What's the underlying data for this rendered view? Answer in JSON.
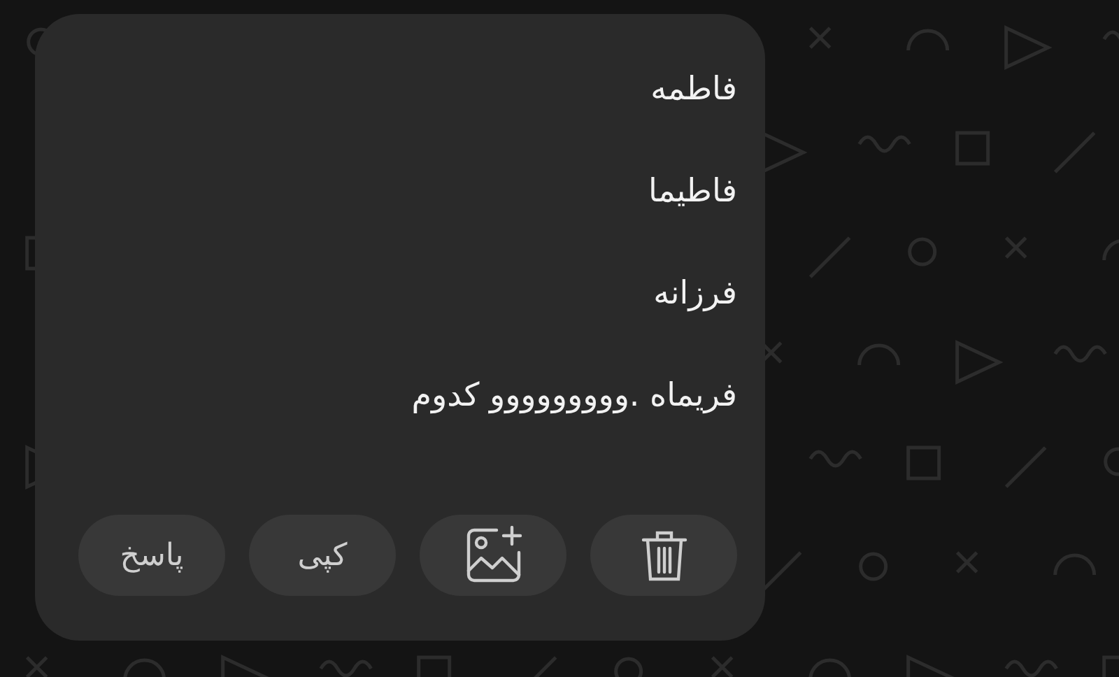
{
  "message": {
    "lines": [
      "فاطمه",
      "فاطیما",
      "فرزانه",
      "فریماه .ووووووووو کدوم"
    ]
  },
  "actions": [
    {
      "kind": "delete"
    },
    {
      "kind": "attach"
    },
    {
      "kind": "text",
      "label": "کپی"
    },
    {
      "kind": "text",
      "label": "پاسخ"
    }
  ]
}
